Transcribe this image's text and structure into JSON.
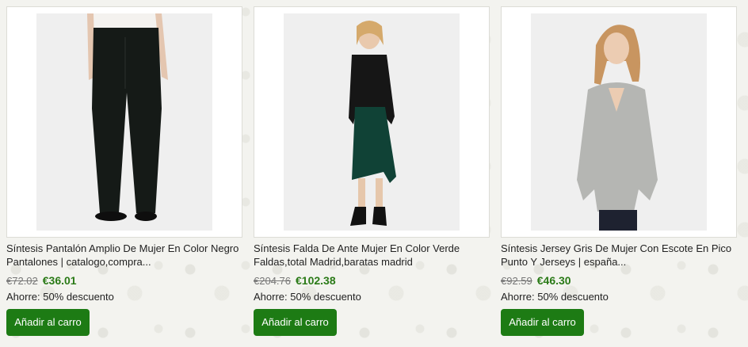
{
  "products": [
    {
      "title_line1": "Síntesis Pantalón Amplio De Mujer En Color Negro",
      "title_line2": "Pantalones | catalogo,compra...",
      "old_price": "€72.02",
      "new_price": "€36.01",
      "discount": "Ahorre: 50% descuento",
      "button": "Añadir al carro",
      "image": "black-wide-trousers-photo"
    },
    {
      "title_line1": "Síntesis Falda De Ante Mujer En Color Verde",
      "title_line2": "Faldas,total Madrid,baratas madrid",
      "old_price": "€204.76",
      "new_price": "€102.38",
      "discount": "Ahorre: 50% descuento",
      "button": "Añadir al carro",
      "image": "green-suede-skirt-photo"
    },
    {
      "title_line1": "Síntesis Jersey Gris De Mujer Con Escote En Pico",
      "title_line2": "Punto Y Jerseys | españa...",
      "old_price": "€92.59",
      "new_price": "€46.30",
      "discount": "Ahorre: 50% descuento",
      "button": "Añadir al carro",
      "image": "grey-vneck-sweater-photo"
    }
  ],
  "colors": {
    "button_bg": "#1d7b14",
    "new_price": "#2a7a17",
    "old_price": "#777777"
  }
}
